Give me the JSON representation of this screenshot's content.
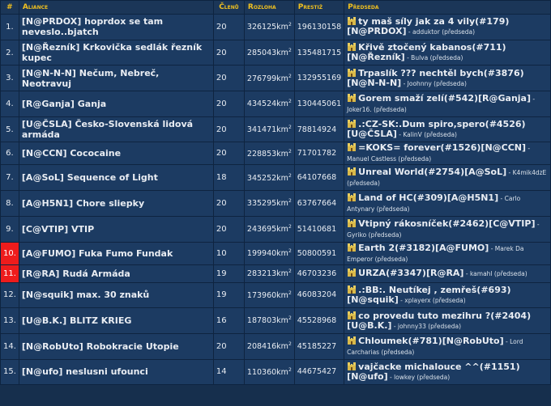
{
  "headers": {
    "rank": "#",
    "alliance": "Aliance",
    "members": "Členů",
    "area": "Rozloha",
    "prestige": "Prestiž",
    "chair": "Předseda"
  },
  "area_unit": "km",
  "chair_role": "(předseda)",
  "colors": {
    "highlight": "#ee1c1c",
    "header_text": "#f0c020",
    "row_bg": "#1c3b62"
  },
  "rows": [
    {
      "rank": "1.",
      "alliance": "[N@PRDOX] hoprdox se tam neveslo..bjatch",
      "members": "20",
      "area": "326125",
      "prestige": "196130158",
      "capital": "ty maš síly jak za 4 vily(#179)[N@PRDOX]",
      "chief": "adduktor"
    },
    {
      "rank": "2.",
      "alliance": "[N@Řezník] Krkovička sedlák řezník kupec",
      "members": "20",
      "area": "285043",
      "prestige": "135481715",
      "capital": "Křivě ztočený kabanos(#711)[N@Řezník]",
      "chief": "Bulva"
    },
    {
      "rank": "3.",
      "alliance": "[N@N-N-N] Nečum, Nebreč, Neotravuj",
      "members": "20",
      "area": "276799",
      "prestige": "132955169",
      "capital": "Trpaslík ??? nechtěl bych(#3876)[N@N-N-N]",
      "chief": "Joohnny"
    },
    {
      "rank": "4.",
      "alliance": "[R@Ganja] Ganja",
      "members": "20",
      "area": "434524",
      "prestige": "130445061",
      "capital": "Gorem smaží zelí(#542)[R@Ganja]",
      "chief": "Joker16."
    },
    {
      "rank": "5.",
      "alliance": "[U@ČSLA] Česko-Slovenská lidová armáda",
      "members": "20",
      "area": "341471",
      "prestige": "78814924",
      "capital": ".:CZ-SK:.Dum spiro,spero(#4526)[U@ČSLA]",
      "chief": "KalinV"
    },
    {
      "rank": "6.",
      "alliance": "[N@CCN] Cococaine",
      "members": "20",
      "area": "228853",
      "prestige": "71701782",
      "capital": "=KOKS= forever(#1526)[N@CCN]",
      "chief": "Manuel Castless"
    },
    {
      "rank": "7.",
      "alliance": "[A@SoL] Sequence of Light",
      "members": "18",
      "area": "345252",
      "prestige": "64107668",
      "capital": "Unreal World(#2754)[A@SoL]",
      "chief": "K4mik4dzE"
    },
    {
      "rank": "8.",
      "alliance": "[A@H5N1] Chore sliepky",
      "members": "20",
      "area": "335295",
      "prestige": "63767664",
      "capital": "Land of HC(#309)[A@H5N1]",
      "chief": "Carlo Antynary"
    },
    {
      "rank": "9.",
      "alliance": "[C@VTIP] VTIP",
      "members": "20",
      "area": "243695",
      "prestige": "51410681",
      "capital": "Vtipný rákosníček(#2462)[C@VTIP]",
      "chief": "Gyriko"
    },
    {
      "rank": "10.",
      "alliance": "[A@FUMO] Fuka Fumo Fundak",
      "members": "10",
      "area": "199940",
      "prestige": "50800591",
      "capital": "Earth 2(#3182)[A@FUMO]",
      "chief": "Marek Da Emperor"
    },
    {
      "rank": "11.",
      "alliance": "[R@RA] Rudá Armáda",
      "members": "19",
      "area": "283213",
      "prestige": "46703236",
      "capital": "URZA(#3347)[R@RA]",
      "chief": "kamahl"
    },
    {
      "rank": "12.",
      "alliance": "[N@squik] max. 30 znaků",
      "members": "19",
      "area": "173960",
      "prestige": "46083204",
      "capital": ".:BB:. Neutíkej , zemřeš(#693)[N@squik]",
      "chief": "xplayerx"
    },
    {
      "rank": "13.",
      "alliance": "[U@B.K.] BLITZ KRIEG",
      "members": "16",
      "area": "187803",
      "prestige": "45528968",
      "capital": "co provedu tuto mezihru ?(#2404)[U@B.K.]",
      "chief": "johnny33"
    },
    {
      "rank": "14.",
      "alliance": "[N@RobUto] Robokracie Utopie",
      "members": "20",
      "area": "208416",
      "prestige": "45185227",
      "capital": "Chloumek(#781)[N@RobUto]",
      "chief": "Lord Carcharias"
    },
    {
      "rank": "15.",
      "alliance": "[N@ufo] neslusni ufounci",
      "members": "14",
      "area": "110360",
      "prestige": "44675427",
      "capital": "vajčacke michalouce ^^(#1151)[N@ufo]",
      "chief": "lowkey"
    }
  ]
}
